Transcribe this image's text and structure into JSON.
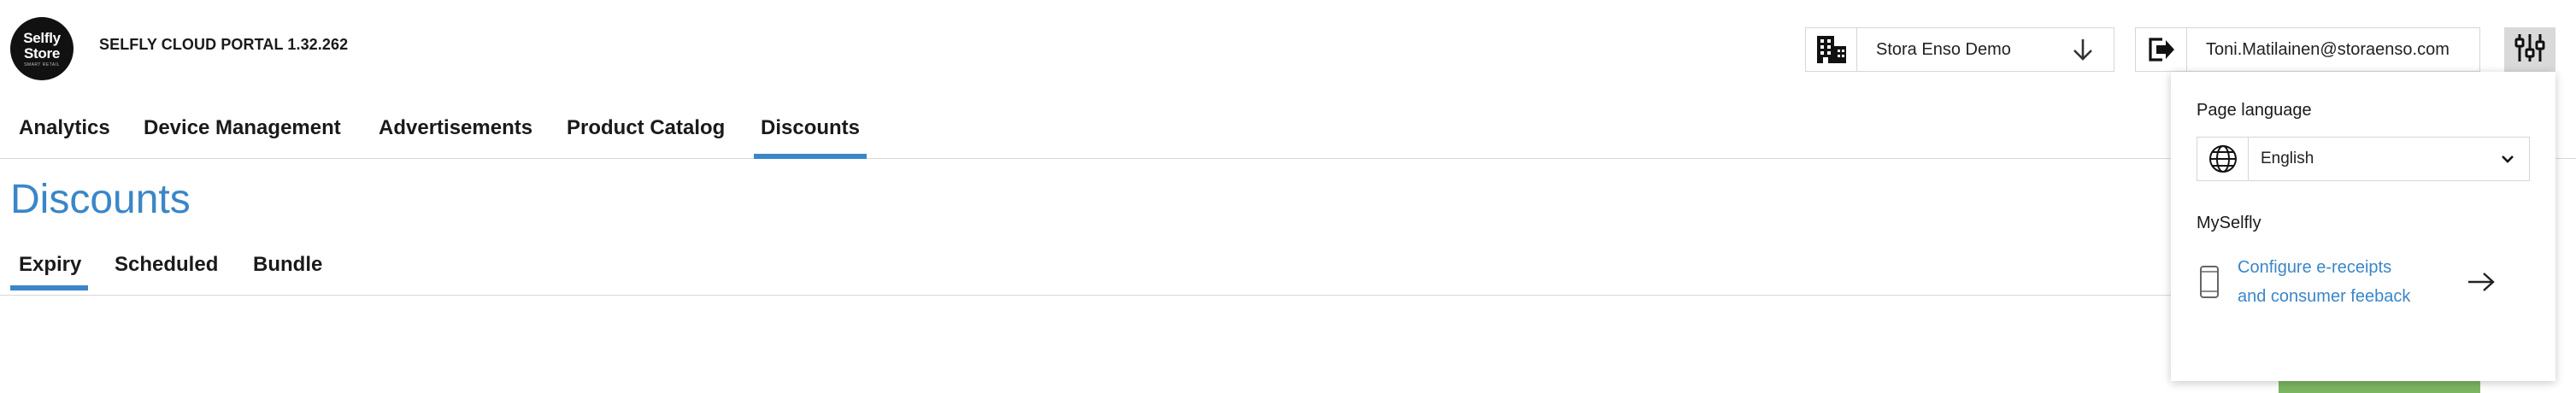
{
  "header": {
    "logo_line1": "Selfly",
    "logo_line2": "Store",
    "logo_tagline": "SMART RETAIL",
    "app_title": "SELFLY CLOUD PORTAL 1.32.262",
    "store_selector": {
      "value": "Stora Enso Demo",
      "icon": "building-icon",
      "arrow_icon": "arrow-down-icon"
    },
    "user": {
      "email": "Toni.Matilainen@storaenso.com",
      "icon": "logout-icon"
    },
    "settings_icon": "sliders-icon"
  },
  "main_nav": {
    "items": [
      {
        "label": "Analytics",
        "active": false
      },
      {
        "label": "Device Management",
        "active": false
      },
      {
        "label": "Advertisements",
        "active": false
      },
      {
        "label": "Product Catalog",
        "active": false
      },
      {
        "label": "Discounts",
        "active": true
      }
    ]
  },
  "page": {
    "title": "Discounts"
  },
  "sub_nav": {
    "items": [
      {
        "label": "Expiry",
        "active": true
      },
      {
        "label": "Scheduled",
        "active": false
      },
      {
        "label": "Bundle",
        "active": false
      }
    ]
  },
  "settings_panel": {
    "language_label": "Page language",
    "language_value": "English",
    "language_icon": "globe-icon",
    "section_label": "MySelfly",
    "link_line1": "Configure e-receipts",
    "link_line2": "and consumer feeback",
    "link_icon": "phone-icon",
    "link_arrow_icon": "arrow-right-icon"
  },
  "colors": {
    "accent": "#3a86c8",
    "action_green": "#7bb661",
    "settings_button_bg": "#d9d9d9"
  }
}
